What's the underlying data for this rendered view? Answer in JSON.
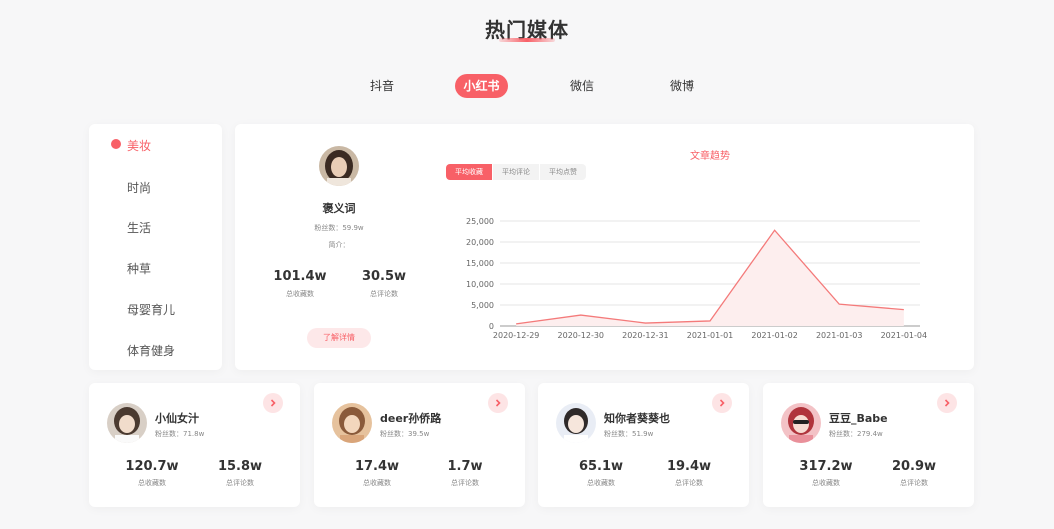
{
  "header": {
    "title": "热门媒体"
  },
  "tabs": [
    {
      "label": "抖音",
      "active": false
    },
    {
      "label": "小红书",
      "active": true
    },
    {
      "label": "微信",
      "active": false
    },
    {
      "label": "微博",
      "active": false
    }
  ],
  "categories": [
    {
      "label": "美妆",
      "active": true
    },
    {
      "label": "时尚",
      "active": false
    },
    {
      "label": "生活",
      "active": false
    },
    {
      "label": "种草",
      "active": false
    },
    {
      "label": "母婴育儿",
      "active": false
    },
    {
      "label": "体育健身",
      "active": false
    }
  ],
  "featured": {
    "name": "褒义词",
    "fans_label": "粉丝数：59.9w",
    "intro_label": "简介：",
    "collect_value": "101.4w",
    "collect_label": "总收藏数",
    "comment_value": "30.5w",
    "comment_label": "总评论数",
    "detail_button": "了解详情"
  },
  "chart_tabs": [
    {
      "label": "平均收藏",
      "active": true
    },
    {
      "label": "平均评论",
      "active": false
    },
    {
      "label": "平均点赞",
      "active": false
    }
  ],
  "chart_data": {
    "type": "area",
    "title": "文章趋势",
    "x": [
      "2020-12-29",
      "2020-12-30",
      "2020-12-31",
      "2021-01-01",
      "2021-01-02",
      "2021-01-03",
      "2021-01-04"
    ],
    "series": [
      {
        "values": [
          500,
          2600,
          700,
          1200,
          22800,
          5200,
          3900
        ]
      }
    ],
    "ylim": [
      0,
      25000
    ],
    "yticks": [
      0,
      5000,
      10000,
      15000,
      20000,
      25000
    ],
    "ytick_labels": [
      "0",
      "5,000",
      "10,000",
      "15,000",
      "20,000",
      "25,000"
    ],
    "grid": true,
    "colors": {
      "line": "#f47a7a",
      "fill": "#fdeeee",
      "grid": "#e6e6e6"
    }
  },
  "users": [
    {
      "name": "小仙女汁",
      "fans": "粉丝数：71.8w",
      "collect": "120.7w",
      "collect_label": "总收藏数",
      "comment": "15.8w",
      "comment_label": "总评论数"
    },
    {
      "name": "deer孙侨路",
      "fans": "粉丝数：39.5w",
      "collect": "17.4w",
      "collect_label": "总收藏数",
      "comment": "1.7w",
      "comment_label": "总评论数"
    },
    {
      "name": "知你者葵葵也",
      "fans": "粉丝数：51.9w",
      "collect": "65.1w",
      "collect_label": "总收藏数",
      "comment": "19.4w",
      "comment_label": "总评论数"
    },
    {
      "name": "豆豆_Babe",
      "fans": "粉丝数：279.4w",
      "collect": "317.2w",
      "collect_label": "总收藏数",
      "comment": "20.9w",
      "comment_label": "总评论数"
    }
  ],
  "icons": {
    "arrow": "chevron-right-icon",
    "avatar": "avatar-photo",
    "active_dot": "dot-indicator"
  },
  "theme": {
    "accent": "#f86067",
    "accent_light": "#fde8e9"
  }
}
